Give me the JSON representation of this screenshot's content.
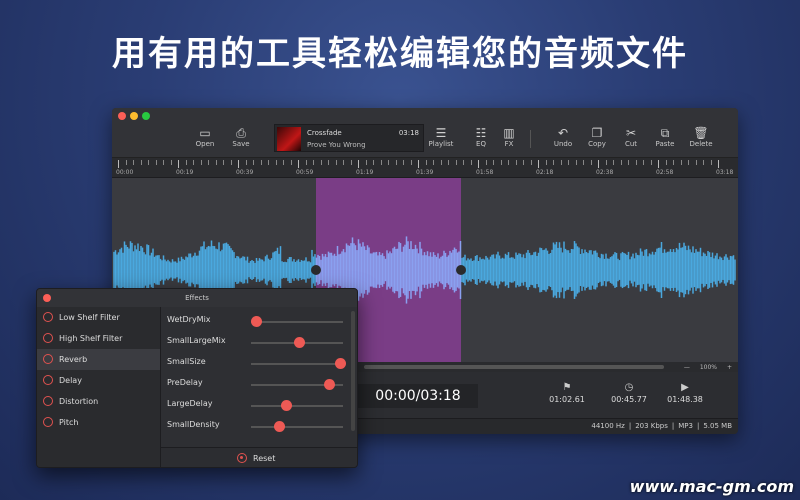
{
  "headline": "用有用的工具轻松编辑您的音频文件",
  "watermark": "www.mac-gm.com",
  "toolbar": {
    "open": "Open",
    "save": "Save",
    "playlist": "Playlist",
    "eq": "EQ",
    "fx": "FX",
    "undo": "Undo",
    "copy": "Copy",
    "cut": "Cut",
    "paste": "Paste",
    "delete": "Delete"
  },
  "track": {
    "name": "Crossfade",
    "subtitle": "Prove You Wrong",
    "duration": "03:18"
  },
  "ruler": [
    "00:00",
    "00:19",
    "00:39",
    "00:59",
    "01:19",
    "01:39",
    "01:58",
    "02:18",
    "02:38",
    "02:58",
    "03:18"
  ],
  "zoom": {
    "minus": "—",
    "value": "100%",
    "plus": "+"
  },
  "transport": {
    "time": "00:00/03:18",
    "start": "01:02.61",
    "length": "00:45.77",
    "end": "01:48.38"
  },
  "status": {
    "rate": "44100 Hz",
    "bitrate": "203 Kbps",
    "format": "MP3",
    "size": "5.05 MB",
    "sep": "|"
  },
  "effects": {
    "title": "Effects",
    "list": [
      "Low Shelf Filter",
      "High Shelf Filter",
      "Reverb",
      "Delay",
      "Distortion",
      "Pitch"
    ],
    "active_index": 2,
    "params": [
      {
        "label": "WetDryMix",
        "value": 0.05
      },
      {
        "label": "SmallLargeMix",
        "value": 0.52
      },
      {
        "label": "SmallSize",
        "value": 0.97
      },
      {
        "label": "PreDelay",
        "value": 0.85
      },
      {
        "label": "LargeDelay",
        "value": 0.38
      },
      {
        "label": "SmallDensity",
        "value": 0.3
      }
    ],
    "reset": "Reset"
  },
  "colors": {
    "wave": "#4aa8de",
    "selection": "#7a3d86",
    "selWave": "#8aa0f0",
    "accent": "#ee5a55"
  }
}
